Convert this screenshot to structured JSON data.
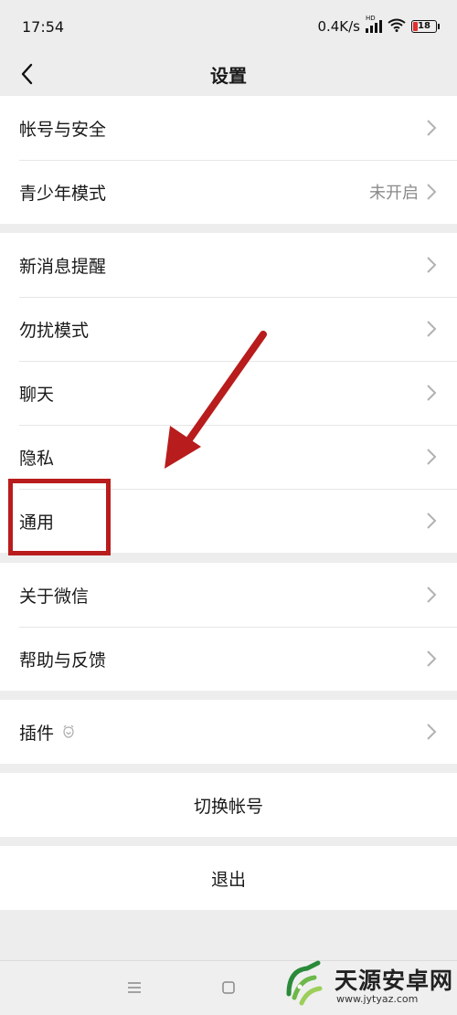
{
  "status": {
    "time": "17:54",
    "speed": "0.4K/s",
    "hd": "HD",
    "battery": "18"
  },
  "header": {
    "title": "设置"
  },
  "groups": [
    [
      {
        "label": "帐号与安全"
      },
      {
        "label": "青少年模式",
        "value": "未开启"
      }
    ],
    [
      {
        "label": "新消息提醒"
      },
      {
        "label": "勿扰模式"
      },
      {
        "label": "聊天"
      },
      {
        "label": "隐私"
      },
      {
        "label": "通用"
      }
    ],
    [
      {
        "label": "关于微信"
      },
      {
        "label": "帮助与反馈"
      }
    ],
    [
      {
        "label": "插件"
      }
    ]
  ],
  "actions": {
    "switch_account": "切换帐号",
    "logout": "退出"
  },
  "annotation": {
    "color": "#b81c1c"
  },
  "watermark": {
    "text": "天源安卓网",
    "url": "www.jytyaz.com"
  }
}
